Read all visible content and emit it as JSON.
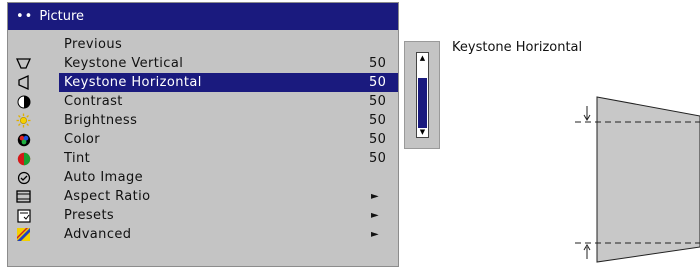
{
  "menu": {
    "title_dots": "••",
    "title": "Picture",
    "items": [
      {
        "icon": "none",
        "label": "Previous",
        "value": "",
        "arrow": ""
      },
      {
        "icon": "keystone-vertical-icon",
        "label": "Keystone Vertical",
        "value": "50",
        "arrow": ""
      },
      {
        "icon": "keystone-horizontal-icon",
        "label": "Keystone Horizontal",
        "value": "50",
        "arrow": "",
        "selected": true
      },
      {
        "icon": "contrast-icon",
        "label": "Contrast",
        "value": "50",
        "arrow": ""
      },
      {
        "icon": "brightness-icon",
        "label": "Brightness",
        "value": "50",
        "arrow": ""
      },
      {
        "icon": "color-icon",
        "label": "Color",
        "value": "50",
        "arrow": ""
      },
      {
        "icon": "tint-icon",
        "label": "Tint",
        "value": "50",
        "arrow": ""
      },
      {
        "icon": "auto-image-icon",
        "label": "Auto Image",
        "value": "",
        "arrow": ""
      },
      {
        "icon": "aspect-ratio-icon",
        "label": "Aspect Ratio",
        "value": "",
        "arrow": "►"
      },
      {
        "icon": "presets-icon",
        "label": "Presets",
        "value": "",
        "arrow": "►"
      },
      {
        "icon": "advanced-icon",
        "label": "Advanced",
        "value": "",
        "arrow": "►"
      }
    ]
  },
  "scrollbar": {
    "up_arrow": "▲",
    "down_arrow": "▼",
    "thumb_fraction": 0.75
  },
  "diagram": {
    "title": "Keystone Horizontal"
  },
  "colors": {
    "highlight": "#1a1a7e",
    "menu_bg": "#c4c4c4",
    "shape_fill": "#c8c8c8"
  }
}
